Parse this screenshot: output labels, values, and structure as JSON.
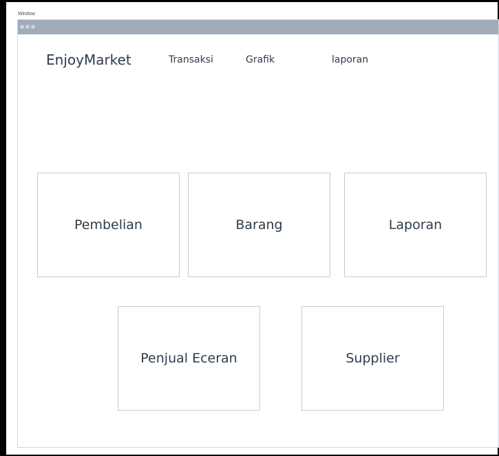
{
  "window": {
    "caption": "Window"
  },
  "header": {
    "brand": "EnjoyMarket",
    "nav": [
      "Transaksi",
      "Grafik",
      "laporan"
    ]
  },
  "cards": [
    "Pembelian",
    "Barang",
    "Laporan",
    "Penjual Eceran",
    "Supplier"
  ],
  "colors": {
    "titlebar": "#a0acb9",
    "text": "#2e3b4b",
    "card_border": "#c3ccd6",
    "frame": "#000000"
  }
}
